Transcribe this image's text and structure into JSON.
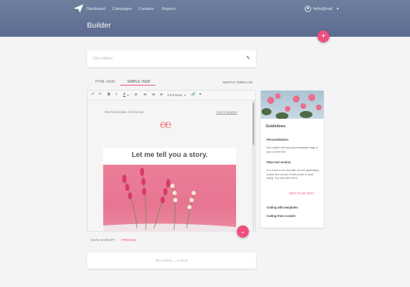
{
  "nav": {
    "items": [
      "Dashboard",
      "Campaigns",
      "Contacts",
      "Reports"
    ],
    "user": "hello@mail"
  },
  "page": {
    "title": "Builder",
    "add_icon": "plus-icon"
  },
  "subject": {
    "placeholder": "Type subject"
  },
  "tabs": [
    "HTML VIEW",
    "SIMPLE VIEW"
  ],
  "active_tab": "SIMPLE VIEW",
  "switch_template": "SWITCH TEMPLATE",
  "toolbar": {
    "font_sizes": "Font Sizes"
  },
  "email": {
    "description": "Short description of this email",
    "view_browser": "View in browser",
    "brand": "ee",
    "headline": "Let me tell you a story."
  },
  "actions": {
    "save_as_draft": "SAVE AS DRAFT",
    "preview": "PREVIEW"
  },
  "test": "Test Gallery → & Send",
  "guidelines": {
    "title": "Guidelines",
    "personalization_title": "Personalization",
    "personalization_text": "We couldn't find any personalization tags in your content file.",
    "plain_text_title": "Plain text section",
    "plain_text_text": "It is a fact to be very late, we are generating a plain text version of this email in short doing. You can edit it here.",
    "edit_link": "EDIT PLAIN TEXT",
    "coding_templates": "Coding with templates",
    "coding_scratch": "Coding from scratch"
  },
  "colors": {
    "accent": "#ee4f7c",
    "header_top": "#6e7f9e",
    "header_bottom": "#5c6b90"
  }
}
